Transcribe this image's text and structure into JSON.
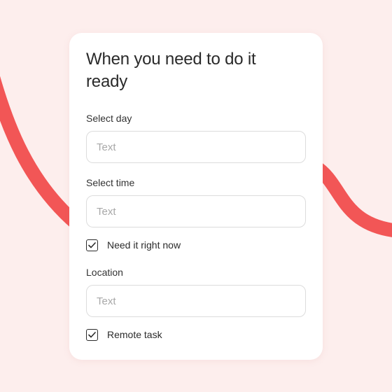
{
  "colors": {
    "background": "#fdeeed",
    "accent_curve": "#f25656",
    "card": "#ffffff",
    "input_border": "#dcdcdc",
    "placeholder": "#a8a8a8"
  },
  "form": {
    "title": "When you need to do it ready",
    "day": {
      "label": "Select day",
      "placeholder": "Text",
      "value": ""
    },
    "time": {
      "label": "Select time",
      "placeholder": "Text",
      "value": ""
    },
    "right_now": {
      "label": "Need it right now",
      "checked": true,
      "icon": "check-icon"
    },
    "location": {
      "label": "Location",
      "placeholder": "Text",
      "value": ""
    },
    "remote": {
      "label": "Remote task",
      "checked": true,
      "icon": "check-icon"
    }
  }
}
